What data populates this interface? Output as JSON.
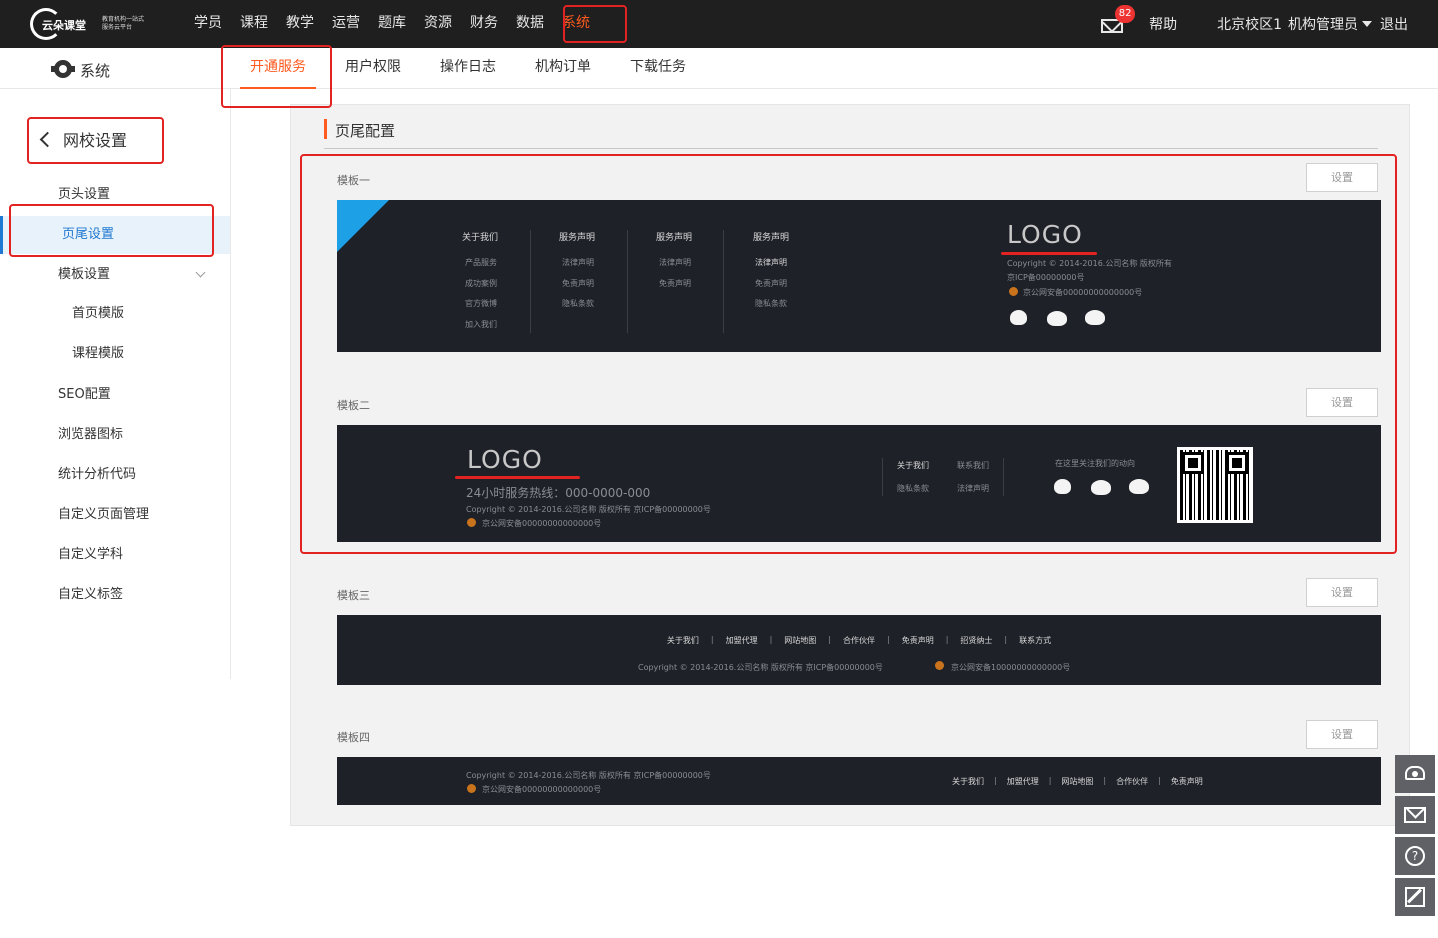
{
  "header": {
    "logo_brand": "云朵课堂",
    "logo_slogan": "教育机构一站式服务云平台",
    "nav": [
      "学员",
      "课程",
      "教学",
      "运营",
      "题库",
      "资源",
      "财务",
      "数据",
      "系统"
    ],
    "active_nav": "系统",
    "mail_badge": "82",
    "help": "帮助",
    "school": "北京校区1",
    "admin": "机构管理员",
    "logout": "退出"
  },
  "subnav": {
    "title": "系统",
    "tabs": [
      "开通服务",
      "用户权限",
      "操作日志",
      "机构订单",
      "下载任务"
    ],
    "active_tab": "开通服务"
  },
  "sidebar": {
    "back_label": "网校设置",
    "items": [
      {
        "label": "页头设置"
      },
      {
        "label": "页尾设置"
      },
      {
        "label": "模板设置"
      },
      {
        "label": "首页模版"
      },
      {
        "label": "课程模版"
      },
      {
        "label": "SEO配置"
      },
      {
        "label": "浏览器图标"
      },
      {
        "label": "统计分析代码"
      },
      {
        "label": "自定义页面管理"
      },
      {
        "label": "自定义学科"
      },
      {
        "label": "自定义标签"
      }
    ],
    "active_item": "页尾设置"
  },
  "main": {
    "section_title": "页尾配置",
    "set_label": "设置",
    "templates": [
      {
        "label": "模板一"
      },
      {
        "label": "模板二"
      },
      {
        "label": "模板三"
      },
      {
        "label": "模板四"
      }
    ]
  },
  "tpl1": {
    "columns": [
      {
        "title": "关于我们",
        "items": [
          "产品服务",
          "成功案例",
          "官方微博",
          "加入我们"
        ]
      },
      {
        "title": "服务声明",
        "items": [
          "法律声明",
          "免责声明",
          "隐私条款"
        ]
      },
      {
        "title": "服务声明",
        "items": [
          "法律声明",
          "免责声明"
        ]
      },
      {
        "title": "服务声明",
        "items": [
          "法律声明",
          "免责声明",
          "隐私条款"
        ]
      }
    ],
    "logo": "LOGO",
    "copyright": "Copyright © 2014-2016.公司名称    版权所有",
    "icp": "京ICP备00000000号",
    "police": "京公网安备00000000000000号"
  },
  "tpl2": {
    "logo": "LOGO",
    "hotline": "24小时服务热线：000-0000-000",
    "copyright": "Copyright © 2014-2016.公司名称    版权所有        京ICP备00000000号",
    "police": "京公网安备00000000000000号",
    "links": [
      "关于我们",
      "联系我们",
      "隐私条款",
      "法律声明"
    ],
    "follow": "在这里关注我们的动向"
  },
  "tpl3": {
    "links": [
      "关于我们",
      "加盟代理",
      "网站地图",
      "合作伙伴",
      "免责声明",
      "招贤纳士",
      "联系方式"
    ],
    "copyright": "Copyright © 2014-2016.公司名称    版权所有    京ICP备00000000号",
    "police": "京公网安备10000000000000号"
  },
  "tpl4": {
    "copyright": "Copyright © 2014-2016.公司名称    版权所有        京ICP备00000000号",
    "police": "京公网安备00000000000000号",
    "links": [
      "关于我们",
      "加盟代理",
      "网站地图",
      "合作伙伴",
      "免责声明"
    ]
  },
  "icons": [
    "settings-gear-icon",
    "mail-icon",
    "caret-down-icon",
    "chevron-left-icon",
    "chevron-down-icon",
    "qq-icon",
    "weibo-icon",
    "wechat-icon",
    "police-badge-icon",
    "qr-code-icon",
    "phone-icon",
    "help-icon",
    "edit-icon"
  ],
  "colors": {
    "accent": "#ff5a1f",
    "active_blue": "#1f78d1",
    "annotation": "#e32222",
    "footer_bg": "#1e2128",
    "topbar_bg": "#1f1f1f"
  }
}
